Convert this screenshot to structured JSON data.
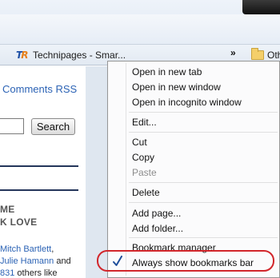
{
  "bookmarks_bar": {
    "items": [
      {
        "label": "Technipages - Smar...",
        "icon": "technipages-favicon"
      },
      {
        "label": "Oth",
        "icon": "folder-icon"
      }
    ],
    "overflow_label": "»"
  },
  "page": {
    "rss_link": "Comments RSS",
    "search_button": "Search",
    "heading_line1": "ME",
    "heading_line2": "K LOVE",
    "text_lines": [
      {
        "before": "",
        "link": "Mitch Bartlett",
        "after": ","
      },
      {
        "before": "",
        "link": "Julie Hamann",
        "after": " and"
      },
      {
        "before": "",
        "link": "831",
        "after": " others like"
      }
    ]
  },
  "context_menu": {
    "items": [
      {
        "label": "Open in new tab",
        "enabled": true
      },
      {
        "label": "Open in new window",
        "enabled": true
      },
      {
        "label": "Open in incognito window",
        "enabled": true
      },
      {
        "label": "Edit...",
        "enabled": true
      },
      {
        "label": "Cut",
        "enabled": true
      },
      {
        "label": "Copy",
        "enabled": true
      },
      {
        "label": "Paste",
        "enabled": false
      },
      {
        "label": "Delete",
        "enabled": true
      },
      {
        "label": "Add page...",
        "enabled": true
      },
      {
        "label": "Add folder...",
        "enabled": true
      },
      {
        "label": "Bookmark manager",
        "enabled": true
      },
      {
        "label": "Always show bookmarks bar",
        "enabled": true,
        "checked": true
      }
    ]
  },
  "colors": {
    "link": "#2c63b5",
    "highlight_ring": "#d2262b",
    "check": "#1f4f9b"
  }
}
